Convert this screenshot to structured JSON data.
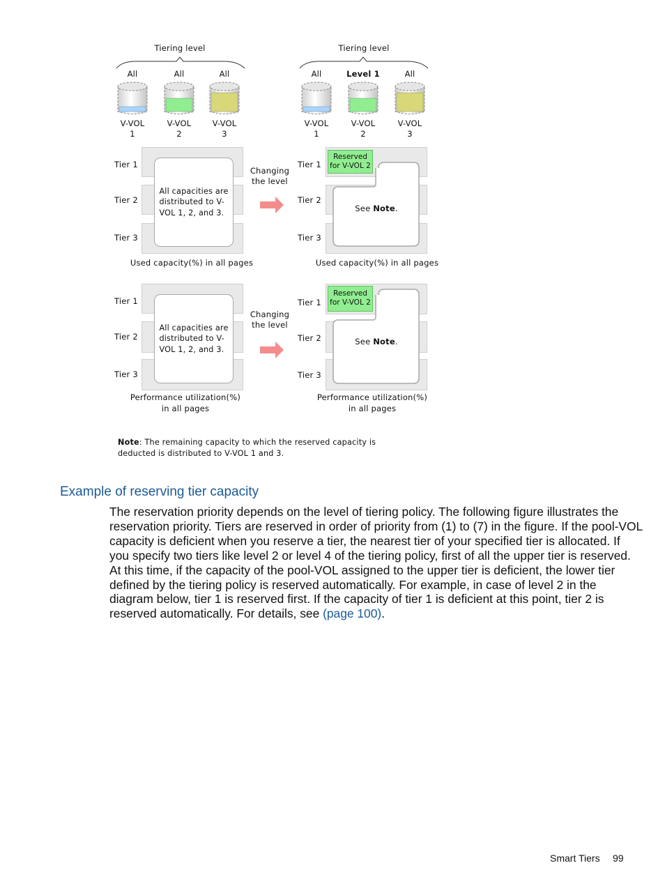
{
  "figure": {
    "left_group": {
      "title": "Tiering level",
      "volumes": [
        {
          "level": "All",
          "name": "V-VOL",
          "number": "1",
          "fill_fraction": 0.22,
          "color": "#a8d4ff"
        },
        {
          "level": "All",
          "name": "V-VOL",
          "number": "2",
          "fill_fraction": 0.6,
          "color": "#90ee90"
        },
        {
          "level": "All",
          "name": "V-VOL",
          "number": "3",
          "fill_fraction": 0.85,
          "color": "#d8d878"
        }
      ]
    },
    "right_group": {
      "title": "Tiering level",
      "volumes": [
        {
          "level": "All",
          "name": "V-VOL",
          "number": "1",
          "fill_fraction": 0.22,
          "color": "#a8d4ff"
        },
        {
          "level": "Level 1",
          "name": "V-VOL",
          "number": "2",
          "fill_fraction": 0.6,
          "color": "#90ee90",
          "bold": true
        },
        {
          "level": "All",
          "name": "V-VOL",
          "number": "3",
          "fill_fraction": 0.85,
          "color": "#d8d878"
        }
      ]
    },
    "tiers": [
      "Tier 1",
      "Tier 2",
      "Tier 3"
    ],
    "changing_label": [
      "Changing",
      "the level"
    ],
    "before_box_text": [
      "All capacities are",
      "distributed to V-",
      "VOL 1, 2, and 3."
    ],
    "reserved_label": [
      "Reserved",
      "for V-VOL 2"
    ],
    "after_box_text_prefix": "See ",
    "after_box_text_bold": "Note",
    "after_box_text_suffix": ".",
    "panel1_caption": "Used capacity(%) in all pages",
    "panel2_caption": [
      "Performance utilization(%)",
      "in all pages"
    ],
    "note_label": "Note",
    "note_text_line1": ": The remaining capacity to which the reserved capacity is",
    "note_text_line2": "deducted is distributed to V-VOL 1 and 3.",
    "colors": {
      "arrow": "#f48c8c",
      "reserved": "#90ee90",
      "tier_band": "#e9e9e9"
    }
  },
  "section": {
    "heading": "Example of reserving tier capacity",
    "paragraph_lines": [
      "The reservation priority depends on the level of tiering policy. The following figure illustrates the",
      "reservation priority. Tiers are reserved in order of priority from (1) to (7) in the figure. If the pool-VOL",
      "capacity is deficient when you reserve a tier, the nearest tier of your specified tier is allocated. If",
      "you specify two tiers like level 2 or level 4 of the tiering policy, first of all the upper tier is reserved.",
      "At this time, if the capacity of the pool-VOL assigned to the upper tier is deficient, the lower tier",
      "defined by the tiering policy is reserved automatically. For example, in case of level 2 in the",
      "diagram below, tier 1 is reserved first. If the capacity of tier 1 is deficient at this point, tier 2 is"
    ],
    "last_line_prefix": "reserved automatically. For details, see ",
    "link_text": "(page 100)",
    "last_line_suffix": "."
  },
  "footer": {
    "section_name": "Smart Tiers",
    "page_number": "99"
  }
}
